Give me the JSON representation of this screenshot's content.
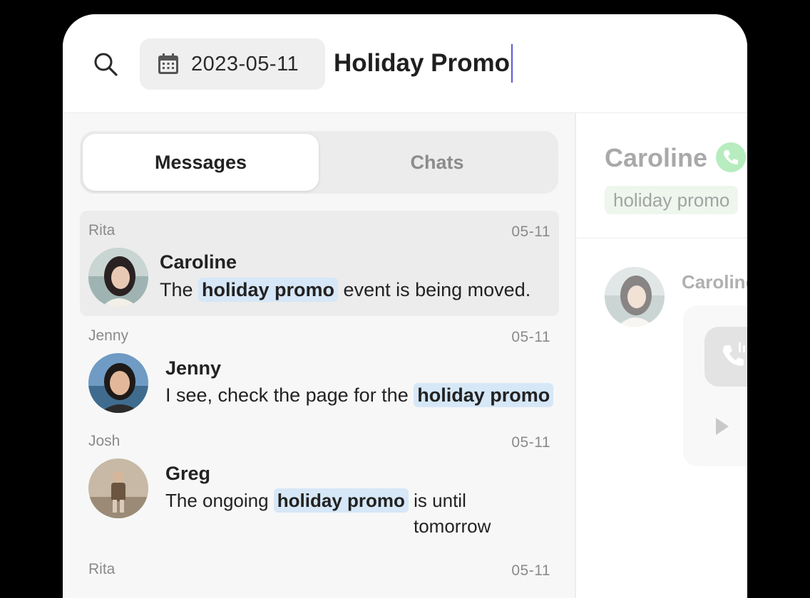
{
  "search": {
    "date_filter": "2023-05-11",
    "query": "Holiday Promo"
  },
  "tabs": [
    {
      "label": "Messages",
      "active": true
    },
    {
      "label": "Chats",
      "active": false
    }
  ],
  "results": [
    {
      "owner": "Rita",
      "date": "05-11",
      "sender": "Caroline",
      "before": "The ",
      "highlight": "holiday promo",
      "after": " event is being moved."
    },
    {
      "owner": "Jenny",
      "date": "05-11",
      "sender": "Jenny",
      "before": "I see, check the page for the ",
      "highlight": "holiday promo",
      "after": ""
    },
    {
      "owner": "Josh",
      "date": "05-11",
      "sender": "Greg",
      "before": "The ongoing ",
      "highlight": "holiday promo",
      "after": " is until",
      "after_line2": "tomorrow"
    },
    {
      "owner": "Rita",
      "date": "05-11"
    }
  ],
  "detail": {
    "title": "Caroline",
    "tag": "holiday promo",
    "message_sender": "Caroline"
  },
  "colors": {
    "highlight_bg": "#d6e7f7",
    "caret": "#5a5ad6",
    "phone_badge": "#b7ecbf"
  },
  "icons": [
    "search-icon",
    "calendar-icon",
    "phone-icon",
    "voice-call-icon",
    "play-icon"
  ]
}
